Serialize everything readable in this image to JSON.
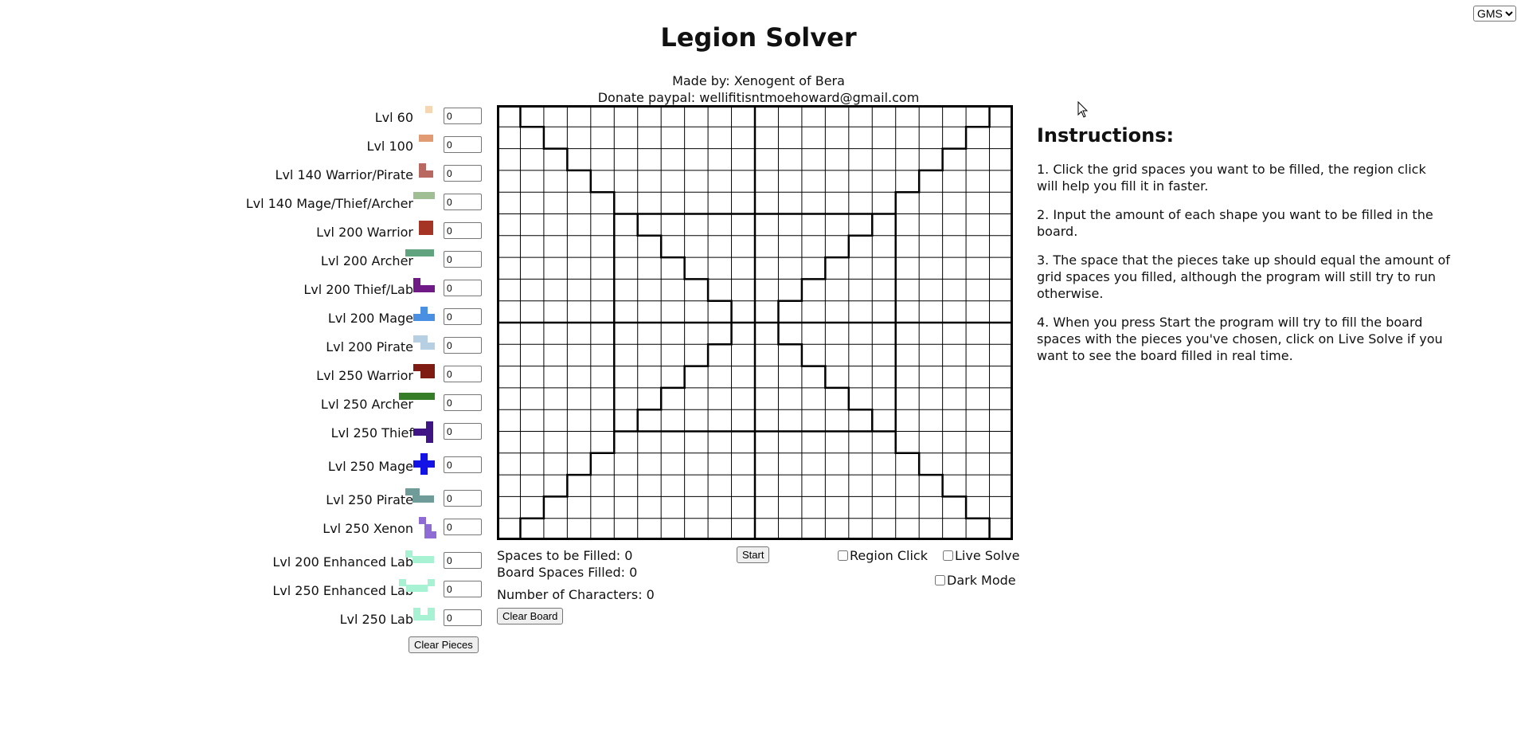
{
  "header": {
    "title": "Legion Solver",
    "credit": "Made by: Xenogent of Bera",
    "donate": "Donate paypal: wellifitisntmoehoward@gmail.com",
    "region_selected": "GMS"
  },
  "pieces": [
    {
      "label": "Lvl 60",
      "value": "0",
      "color": "#f5d7b3"
    },
    {
      "label": "Lvl 100",
      "value": "0",
      "color": "#e29a72"
    },
    {
      "label": "Lvl 140 Warrior/Pirate",
      "value": "0",
      "color": "#b86860"
    },
    {
      "label": "Lvl 140 Mage/Thief/Archer",
      "value": "0",
      "color": "#9fbe93"
    },
    {
      "label": "Lvl 200 Warrior",
      "value": "0",
      "color": "#a53425"
    },
    {
      "label": "Lvl 200 Archer",
      "value": "0",
      "color": "#5fa47f"
    },
    {
      "label": "Lvl 200 Thief/Lab",
      "value": "0",
      "color": "#6f1a86"
    },
    {
      "label": "Lvl 200 Mage",
      "value": "0",
      "color": "#4a90e2"
    },
    {
      "label": "Lvl 200 Pirate",
      "value": "0",
      "color": "#b7cfe2"
    },
    {
      "label": "Lvl 250 Warrior",
      "value": "0",
      "color": "#7e1c14"
    },
    {
      "label": "Lvl 250 Archer",
      "value": "0",
      "color": "#357d27"
    },
    {
      "label": "Lvl 250 Thief",
      "value": "0",
      "color": "#3f1485"
    },
    {
      "label": "Lvl 250 Mage",
      "value": "0",
      "color": "#1313e6"
    },
    {
      "label": "Lvl 250 Pirate",
      "value": "0",
      "color": "#6f9b98"
    },
    {
      "label": "Lvl 250 Xenon",
      "value": "0",
      "color": "#8f6bd6"
    },
    {
      "label": "Lvl 200 Enhanced Lab",
      "value": "0",
      "color": "#a6f2d2"
    },
    {
      "label": "Lvl 250 Enhanced Lab",
      "value": "0",
      "color": "#a6f2d2"
    },
    {
      "label": "Lvl 250 Lab",
      "value": "0",
      "color": "#a6f2d2"
    }
  ],
  "buttons": {
    "clear_pieces": "Clear Pieces",
    "start": "Start",
    "clear_board": "Clear Board"
  },
  "stats": {
    "spaces_to_fill": "Spaces to be Filled: 0",
    "board_filled": "Board Spaces Filled: 0",
    "num_characters": "Number of Characters: 0"
  },
  "options": {
    "region_click": "Region Click",
    "live_solve": "Live Solve",
    "dark_mode": "Dark Mode"
  },
  "instructions": {
    "heading": "Instructions:",
    "steps": [
      "1. Click the grid spaces you want to be filled, the region click will help you fill it in faster.",
      "2. Input the amount of each shape you want to be filled in the board.",
      "3. The space that the pieces take up should equal the amount of grid spaces you filled, although the program will still try to run otherwise.",
      "4. When you press Start the program will try to fill the board spaces with the pieces you've chosen, click on Live Solve if you want to see the board filled in real time."
    ]
  },
  "board": {
    "rows": 20,
    "cols": 22
  }
}
